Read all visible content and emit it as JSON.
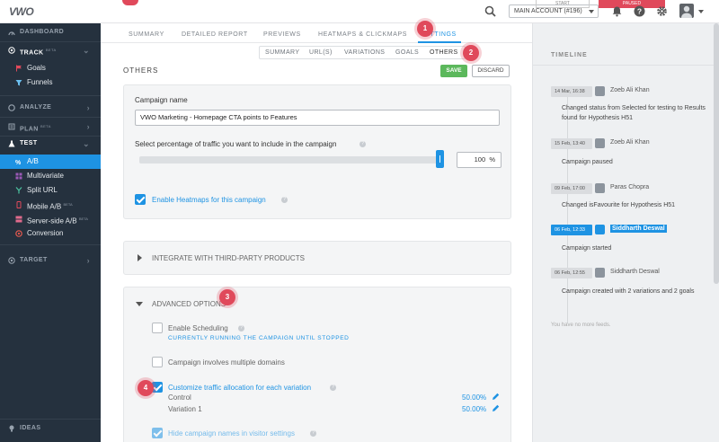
{
  "topbar": {
    "logo": "VWO",
    "account": "MAIN ACCOUNT (#196)",
    "start_label": "START",
    "pause_label": "PAUSED"
  },
  "sidebar": {
    "dashboard": "DASHBOARD",
    "track": "TRACK",
    "track_beta": "BETA",
    "goals": "Goals",
    "funnels": "Funnels",
    "analyze": "ANALYZE",
    "plan": "PLAN",
    "plan_beta": "BETA",
    "test": "TEST",
    "ab": "A/B",
    "multivariate": "Multivariate",
    "split_url": "Split URL",
    "mobile_ab": "Mobile A/B",
    "mobile_beta": "BETA",
    "server_side": "Server-side A/B",
    "server_beta": "BETA",
    "conversion": "Conversion",
    "target": "TARGET",
    "ideas": "IDEAS"
  },
  "tabs": [
    "SUMMARY",
    "DETAILED REPORT",
    "PREVIEWS",
    "HEATMAPS & CLICKMAPS",
    "SETTINGS"
  ],
  "subtabs": [
    "SUMMARY",
    "URL(S)",
    "VARIATIONS",
    "GOALS",
    "OTHERS"
  ],
  "page": {
    "heading": "OTHERS",
    "save": "SAVE",
    "discard": "DISCARD"
  },
  "settings": {
    "campaign_name_label": "Campaign name",
    "campaign_name_value": "VWO Marketing - Homepage CTA points to Features",
    "traffic_label": "Select percentage of traffic you want to include in the campaign",
    "traffic_value": "100",
    "traffic_unit": "%",
    "traffic_fraction": 1.0,
    "heatmaps_label": "Enable Heatmaps for this campaign"
  },
  "integrate": {
    "label": "INTEGRATE WITH THIRD-PARTY PRODUCTS"
  },
  "advanced": {
    "label": "ADVANCED OPTIONS",
    "scheduling_label": "Enable Scheduling",
    "scheduling_note": "CURRENTLY RUNNING THE CAMPAIGN UNTIL STOPPED",
    "multi_domain_label": "Campaign involves multiple domains",
    "traffic_alloc_label": "Customize traffic allocation for each variation",
    "variations": [
      {
        "name": "Control",
        "value": "50.00%"
      },
      {
        "name": "Variation 1",
        "value": "50.00%"
      }
    ],
    "hide_names_label": "Hide campaign names in visitor settings"
  },
  "badges": [
    "1",
    "2",
    "3",
    "4"
  ],
  "timeline": {
    "title": "TIMELINE",
    "entries": [
      {
        "date": "14 Mar, 16:38",
        "name": "Zoeb Ali Khan",
        "text": "Changed status from Selected for testing to Results found for Hypothesis H51"
      },
      {
        "date": "15 Feb, 13:40",
        "name": "Zoeb Ali Khan",
        "text": "Campaign paused"
      },
      {
        "date": "09 Feb, 17:00",
        "name": "Paras Chopra",
        "text": "Changed isFavourite for Hypothesis H51"
      },
      {
        "date": "06 Feb, 12:33",
        "name": "Siddharth Deswal",
        "text": "Campaign started"
      },
      {
        "date": "06 Feb, 12:55",
        "name": "Siddharth Deswal",
        "text": "Campaign created with 2 variations and 2 goals"
      }
    ],
    "no_more": "You have no more feeds."
  },
  "colors": {
    "accent": "#1e93e3",
    "sidebar": "#25313e",
    "save": "#5cb85c",
    "badge": "#e0495b"
  }
}
